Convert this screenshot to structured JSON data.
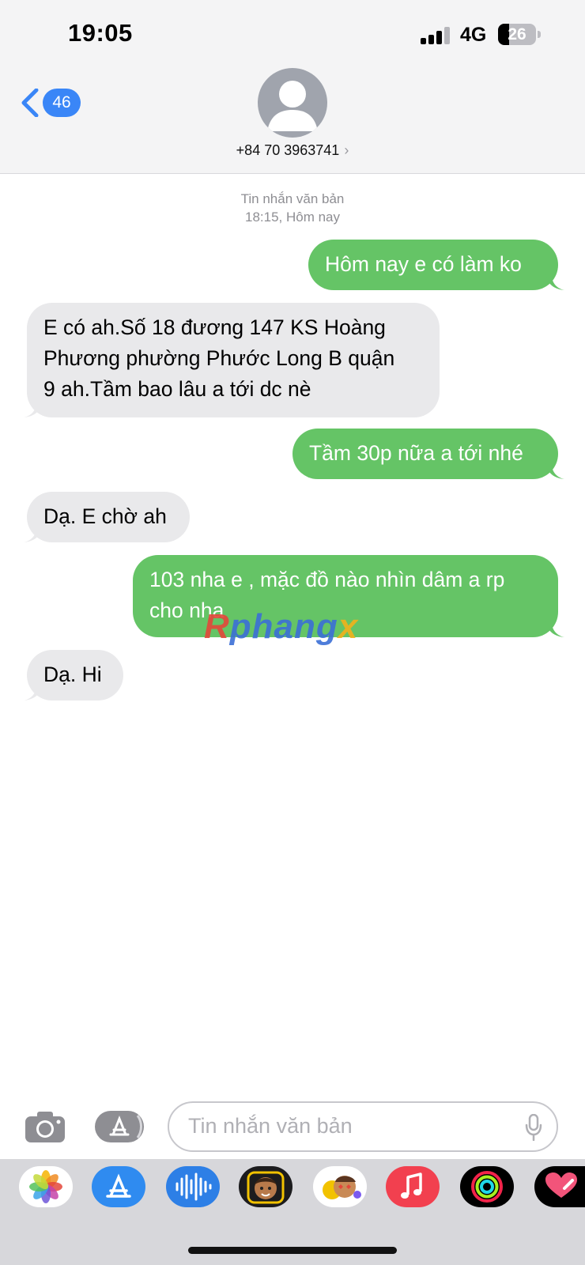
{
  "status_bar": {
    "time": "19:05",
    "network": "4G",
    "battery": "26"
  },
  "nav": {
    "back_count": "46",
    "contact": "+84 70 3963741"
  },
  "conversation": {
    "label": "Tin nhắn văn bản",
    "timestamp": "18:15, Hôm nay",
    "messages": [
      {
        "direction": "outgoing",
        "text": "Hôm nay e có làm ko"
      },
      {
        "direction": "incoming",
        "line1": "E có ah.Số 18 đương 147 KS Hoàng",
        "line2": "Phương phường Phước Long B quận",
        "line3": "9 ah.Tầm bao lâu a tới dc nè"
      },
      {
        "direction": "outgoing",
        "text": "Tầm 30p nữa a tới nhé"
      },
      {
        "direction": "incoming",
        "text": "Dạ. E chờ ah"
      },
      {
        "direction": "outgoing",
        "line1": "103 nha e , mặc đồ nào nhìn dâm a rp",
        "line2": "cho nha"
      },
      {
        "direction": "incoming",
        "text": "Dạ. Hi"
      }
    ]
  },
  "watermark": {
    "part1": "R",
    "part2": "phang",
    "part3": "x"
  },
  "input": {
    "placeholder": "Tin nhắn văn bản"
  },
  "app_drawer": [
    "photos-icon",
    "app-store-icon",
    "audio-message-icon",
    "memoji-icon",
    "animoji-stickers-icon",
    "music-icon",
    "activity-icon",
    "digital-touch-icon"
  ],
  "colors": {
    "outgoing_bubble": "#65c466",
    "incoming_bubble": "#e9e9eb",
    "accent": "#3a86f7"
  }
}
